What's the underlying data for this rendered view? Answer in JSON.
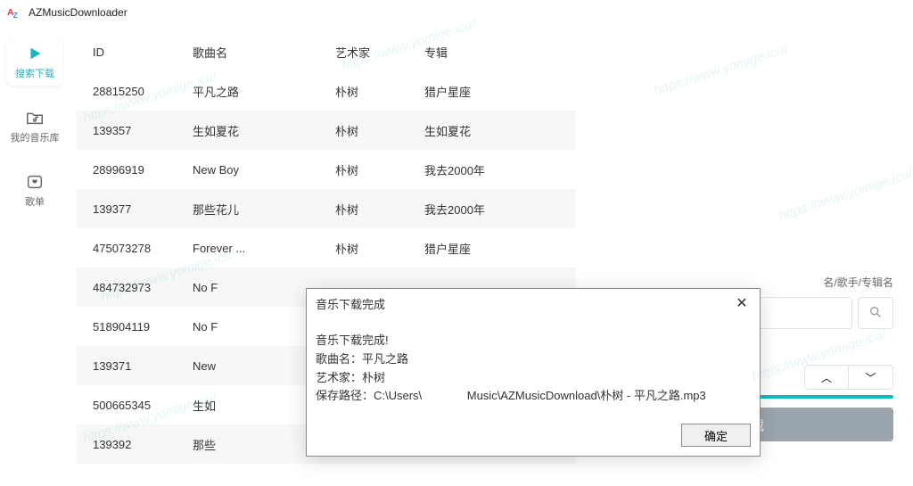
{
  "app": {
    "title": "AZMusicDownloader"
  },
  "sidebar": {
    "items": [
      {
        "label": "搜索下载"
      },
      {
        "label": "我的音乐库"
      },
      {
        "label": "歌单"
      }
    ]
  },
  "table": {
    "headers": {
      "id": "ID",
      "name": "歌曲名",
      "artist": "艺术家",
      "album": "专辑"
    },
    "rows": [
      {
        "id": "28815250",
        "name": "平凡之路",
        "artist": "朴树",
        "album": "猎户星座"
      },
      {
        "id": "139357",
        "name": "生如夏花",
        "artist": "朴树",
        "album": "生如夏花"
      },
      {
        "id": "28996919",
        "name": "New Boy",
        "artist": "朴树",
        "album": "我去2000年"
      },
      {
        "id": "139377",
        "name": "那些花儿",
        "artist": "朴树",
        "album": "我去2000年"
      },
      {
        "id": "475073278",
        "name": "Forever ...",
        "artist": "朴树",
        "album": "猎户星座"
      },
      {
        "id": "484732973",
        "name": "No F",
        "artist": "",
        "album": ""
      },
      {
        "id": "518904119",
        "name": "No F",
        "artist": "",
        "album": ""
      },
      {
        "id": "139371",
        "name": "New",
        "artist": "",
        "album": ""
      },
      {
        "id": "500665345",
        "name": "生如",
        "artist": "",
        "album": ""
      },
      {
        "id": "139392",
        "name": "那些",
        "artist": "",
        "album": ""
      }
    ]
  },
  "search": {
    "hint": "名/歌手/专辑名"
  },
  "download": {
    "button": "下载"
  },
  "dialog": {
    "title": "音乐下载完成",
    "line1": "音乐下载完成!",
    "line2": "歌曲名：平凡之路",
    "line3": "艺术家：朴树",
    "line4_a": "保存路径：C:\\Users\\",
    "line4_b": "Music\\AZMusicDownload\\朴树 - 平凡之路.mp3",
    "ok": "确定"
  },
  "watermark": "https://www.yomige.icu/"
}
